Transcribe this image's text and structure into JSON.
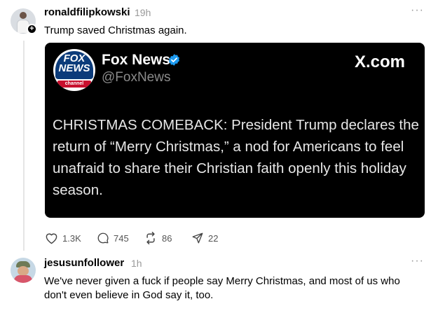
{
  "post": {
    "username": "ronaldfilipkowski",
    "time": "19h",
    "more": "···",
    "follow_badge": "+",
    "text": "Trump saved Christmas again.",
    "embed": {
      "logo_text": "FOX NEWS",
      "logo_sub": "channel",
      "source_name": "Fox News",
      "handle": "@FoxNews",
      "site": "X.com",
      "headline": "CHRISTMAS COMEBACK: President Trump declares the return of “Merry Christmas,” a nod for Americans to feel unafraid to share their Christian faith openly this holiday season."
    },
    "actions": {
      "likes": "1.3K",
      "replies": "745",
      "reposts": "86",
      "shares": "22"
    }
  },
  "reply": {
    "username": "jesusunfollower",
    "time": "1h",
    "more": "···",
    "text": "We've never given a fuck if people say Merry Christmas, and most of us who don't even believe in God say it, too."
  },
  "colors": {
    "embed_bg": "#000000",
    "verified": "#1d9bf0",
    "muted": "#999999"
  },
  "icons": [
    "heart-icon",
    "reply-icon",
    "repost-icon",
    "share-icon",
    "verified-icon",
    "more-icon"
  ]
}
